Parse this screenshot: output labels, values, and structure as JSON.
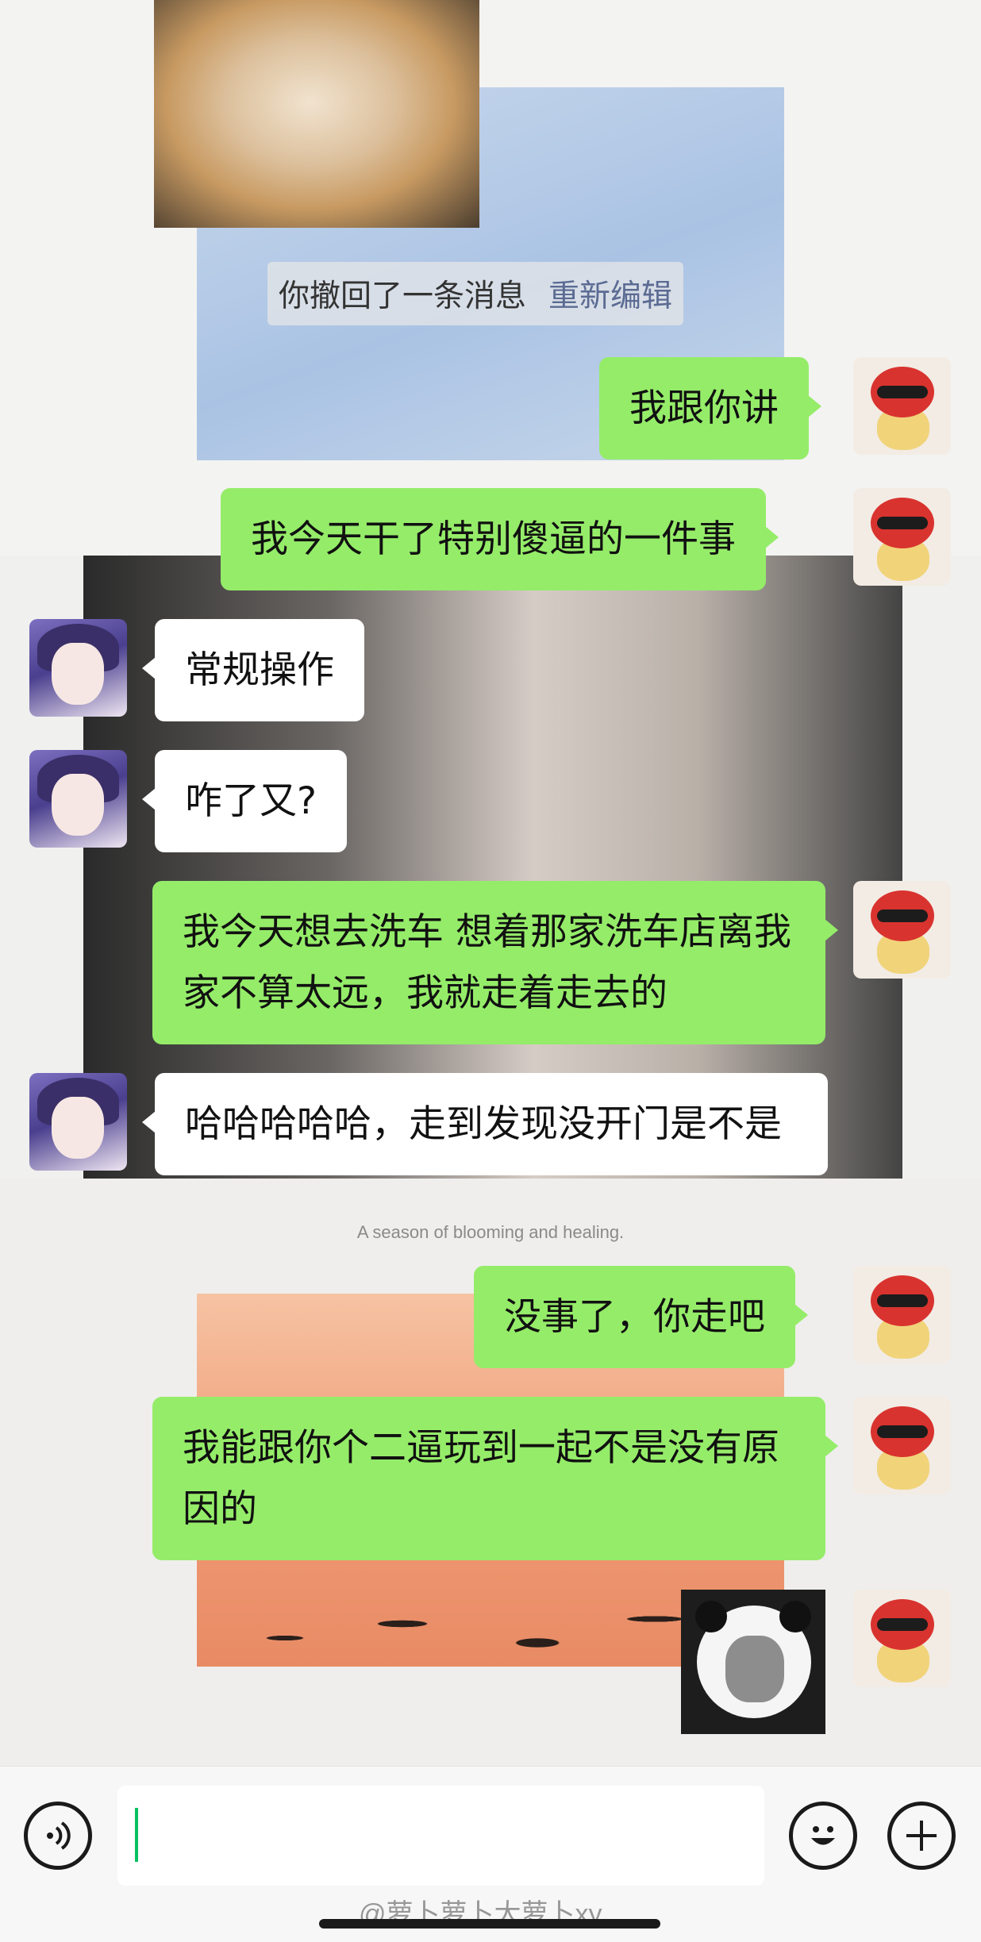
{
  "system_tip": {
    "text": "你撤回了一条消息",
    "action": "重新编辑"
  },
  "background": {
    "caption": "A season of blooming and healing."
  },
  "messages": [
    {
      "side": "right",
      "text": "我跟你讲"
    },
    {
      "side": "right",
      "text": "我今天干了特别傻逼的一件事"
    },
    {
      "side": "left",
      "text": "常规操作"
    },
    {
      "side": "left",
      "text": "咋了又?"
    },
    {
      "side": "right",
      "text": "我今天想去洗车 想着那家洗车店离我家不算太远，我就走着走去的"
    },
    {
      "side": "left",
      "text": "哈哈哈哈哈，走到发现没开门是不是"
    },
    {
      "side": "right",
      "text": "没事了，你走吧"
    },
    {
      "side": "right",
      "text": "我能跟你个二逼玩到一起不是没有原因的"
    },
    {
      "side": "right",
      "sticker": "panda-meme-sticker"
    }
  ],
  "input_bar": {
    "voice_icon": "voice-icon",
    "emoji_icon": "emoji-icon",
    "plus_icon": "plus-icon",
    "input_value": ""
  },
  "watermark": "@萝卜萝卜大萝卜xy"
}
